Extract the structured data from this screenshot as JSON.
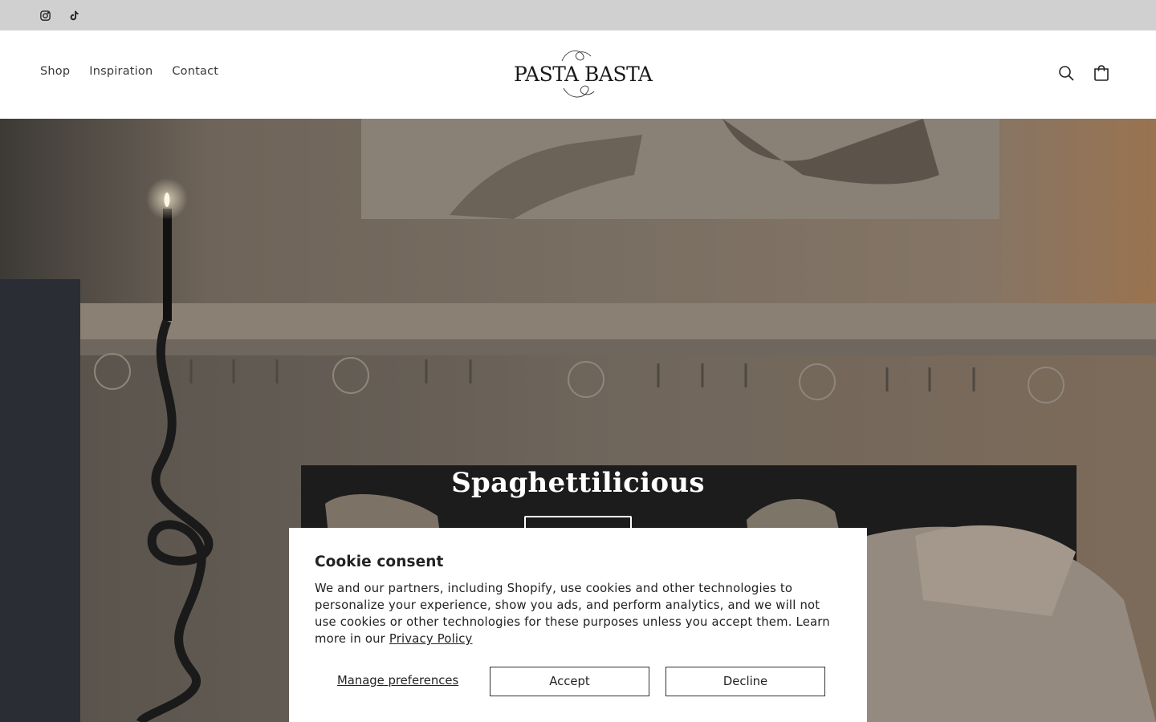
{
  "announcement_bar": {
    "social": [
      {
        "icon": "instagram-icon"
      },
      {
        "icon": "tiktok-icon"
      }
    ]
  },
  "header": {
    "nav": [
      "Shop",
      "Inspiration",
      "Contact"
    ],
    "logo_text": "PASTA BASTA",
    "icons": [
      "search-icon",
      "cart-icon"
    ]
  },
  "hero": {
    "title": "Spaghettilicious"
  },
  "cookie": {
    "title": "Cookie consent",
    "body": "We and our partners, including Shopify, use cookies and other technologies to personalize your experience, show you ads, and perform analytics, and we will not use cookies or other technologies for these purposes unless you accept them. Learn more in our ",
    "privacy_link": "Privacy Policy",
    "manage_label": "Manage preferences",
    "accept_label": "Accept",
    "decline_label": "Decline"
  },
  "colors": {
    "announcement_bg": "#d0d0d0",
    "header_bg": "#ffffff",
    "text": "#121212"
  }
}
